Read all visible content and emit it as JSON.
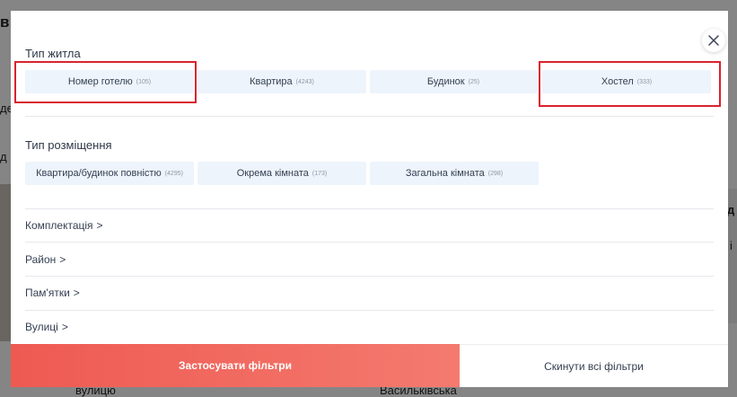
{
  "background": {
    "left_fragment_1": "в",
    "left_fragment_2": "де",
    "left_fragment_3": "д н",
    "right_fragment_1": "д",
    "right_fragment_2": "і",
    "bottom_left_text": "вулицю",
    "bottom_right_text": "Васильківська"
  },
  "modal": {
    "housing_type": {
      "title": "Тип житла",
      "options": [
        {
          "label": "Номер готелю",
          "count": "(105)"
        },
        {
          "label": "Квартира",
          "count": "(4243)"
        },
        {
          "label": "Будинок",
          "count": "(25)"
        },
        {
          "label": "Хостел",
          "count": "(333)"
        }
      ]
    },
    "accommodation_type": {
      "title": "Тип розміщення",
      "options": [
        {
          "label": "Квартира/будинок повністю",
          "count": "(4295)"
        },
        {
          "label": "Окрема кімната",
          "count": "(173)"
        },
        {
          "label": "Загальна кімната",
          "count": "(298)"
        }
      ]
    },
    "collapsibles": [
      {
        "label": "Комплектація",
        "chevron": ">"
      },
      {
        "label": "Район",
        "chevron": ">"
      },
      {
        "label": "Пам'ятки",
        "chevron": ">"
      },
      {
        "label": "Вулиці",
        "chevron": ">"
      }
    ],
    "footer": {
      "apply_label": "Застосувати фільтри",
      "reset_label": "Скинути всі фільтри"
    },
    "icons": {
      "close": "close-icon"
    },
    "colors": {
      "accent": "#ee5a52",
      "chip_bg": "#eef4fc",
      "highlight": "#d9232f"
    }
  }
}
